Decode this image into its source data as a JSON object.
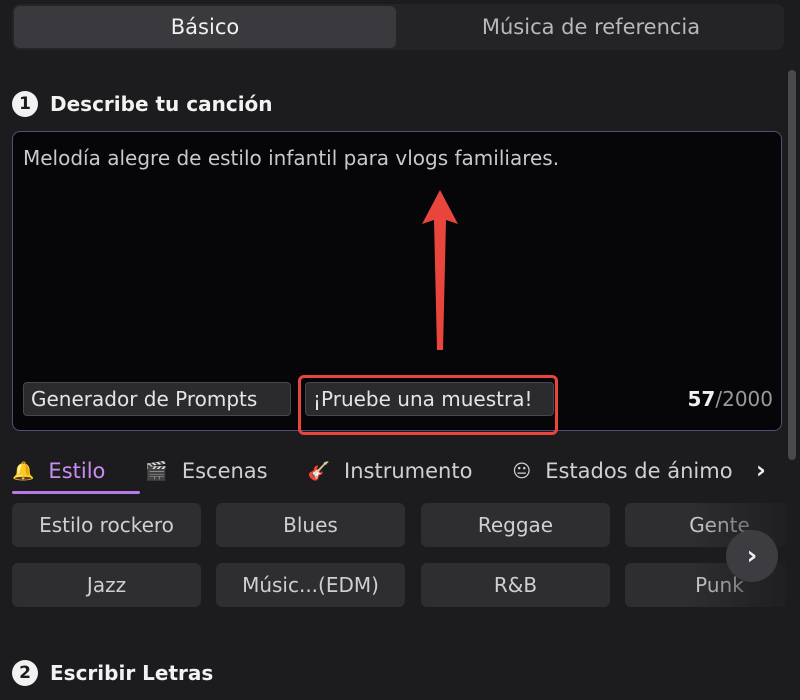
{
  "tabs": [
    {
      "label": "Básico",
      "active": true
    },
    {
      "label": "Música de referencia",
      "active": false
    }
  ],
  "section1": {
    "number": "1",
    "title": "Describe tu canción"
  },
  "prompt": {
    "value": "Melodía alegre de estilo infantil para vlogs familiares.",
    "generator_label": "Generador de Prompts",
    "sample_label": "¡Pruebe una muestra!",
    "char_count": "57",
    "char_limit": "/2000"
  },
  "categories": [
    {
      "icon": "🔔",
      "icon_name": "bell-icon",
      "label": "Estilo",
      "active": true
    },
    {
      "icon": "🎬",
      "icon_name": "clapperboard-icon",
      "label": "Escenas",
      "active": false
    },
    {
      "icon": "🎸",
      "icon_name": "guitar-icon",
      "label": "Instrumento",
      "active": false
    },
    {
      "icon": "😐",
      "icon_name": "face-icon",
      "label": "Estados de ánimo",
      "active": false
    }
  ],
  "styles": [
    "Estilo rockero",
    "Blues",
    "Reggae",
    "Gente",
    "Jazz",
    "Músic...(EDM)",
    "R&B",
    "Punk"
  ],
  "section2": {
    "number": "2",
    "title": "Escribir Letras"
  },
  "colors": {
    "accent": "#b77ae8",
    "highlight": "#e8453c",
    "background": "#1c1c1e"
  }
}
